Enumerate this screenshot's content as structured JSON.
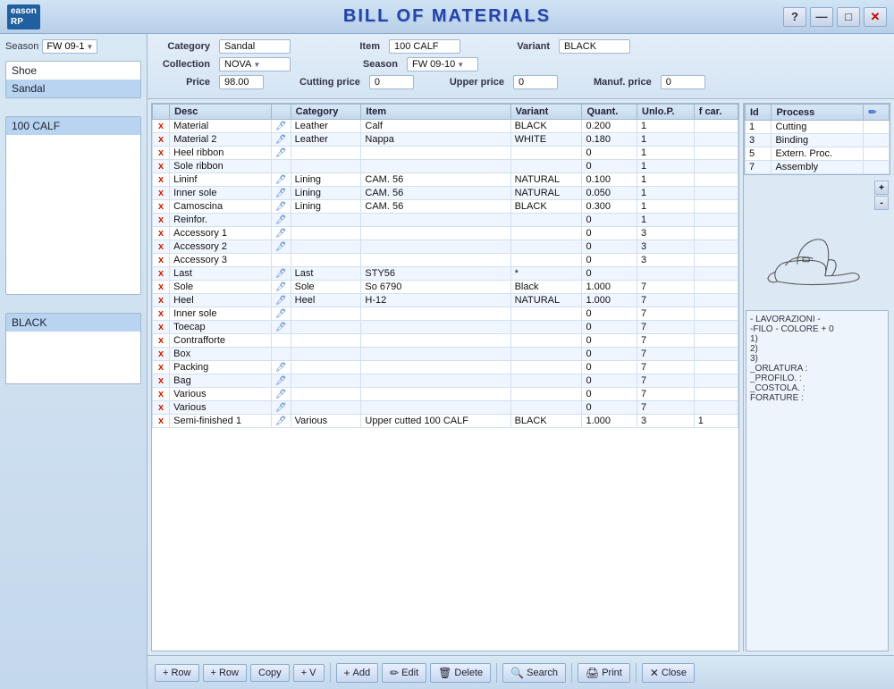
{
  "app": {
    "logo_line1": "eason",
    "logo_line2": "RP",
    "title": "BILL OF MATERIALS"
  },
  "window_controls": {
    "help": "?",
    "minimize": "—",
    "maximize": "□",
    "close": "✕"
  },
  "left_panel": {
    "season_label": "Season",
    "season_value": "FW 09-1",
    "lists": {
      "categories": [
        "Shoe",
        "Sandal"
      ],
      "items": [
        "100 CALF"
      ],
      "variants": [
        "BLACK"
      ]
    }
  },
  "form": {
    "category_label": "Category",
    "category_value": "Sandal",
    "item_label": "Item",
    "item_value": "100 CALF",
    "variant_label": "Variant",
    "variant_value": "BLACK",
    "collection_label": "Collection",
    "collection_value": "NOVA",
    "season_label": "Season",
    "season_value": "FW 09-10",
    "price_label": "Price",
    "price_value": "98.00",
    "cutting_price_label": "Cutting price",
    "cutting_price_value": "0",
    "upper_price_label": "Upper price",
    "upper_price_value": "0",
    "manuf_price_label": "Manuf. price",
    "manuf_price_value": "0"
  },
  "table": {
    "headers": [
      "",
      "Desc",
      "",
      "Category",
      "Item",
      "Variant",
      "Quant.",
      "Unlo.P.",
      "f car."
    ],
    "rows": [
      {
        "x": "x",
        "desc": "Material",
        "edit": true,
        "category": "Leather",
        "item": "Calf",
        "variant": "BLACK",
        "quant": "0.200",
        "unlo": "1",
        "fcar": ""
      },
      {
        "x": "x",
        "desc": "Material 2",
        "edit": true,
        "category": "Leather",
        "item": "Nappa",
        "variant": "WHITE",
        "quant": "0.180",
        "unlo": "1",
        "fcar": ""
      },
      {
        "x": "x",
        "desc": "Heel ribbon",
        "edit": true,
        "category": "",
        "item": "",
        "variant": "",
        "quant": "0",
        "unlo": "1",
        "fcar": ""
      },
      {
        "x": "x",
        "desc": "Sole ribbon",
        "edit": false,
        "category": "",
        "item": "",
        "variant": "",
        "quant": "0",
        "unlo": "1",
        "fcar": ""
      },
      {
        "x": "x",
        "desc": "Lininf",
        "edit": true,
        "category": "Lining",
        "item": "CAM. 56",
        "variant": "NATURAL",
        "quant": "0.100",
        "unlo": "1",
        "fcar": ""
      },
      {
        "x": "x",
        "desc": "Inner sole",
        "edit": true,
        "category": "Lining",
        "item": "CAM. 56",
        "variant": "NATURAL",
        "quant": "0.050",
        "unlo": "1",
        "fcar": ""
      },
      {
        "x": "x",
        "desc": "Camoscina",
        "edit": true,
        "category": "Lining",
        "item": "CAM. 56",
        "variant": "BLACK",
        "quant": "0.300",
        "unlo": "1",
        "fcar": ""
      },
      {
        "x": "x",
        "desc": "Reinfor.",
        "edit": true,
        "category": "",
        "item": "",
        "variant": "",
        "quant": "0",
        "unlo": "1",
        "fcar": ""
      },
      {
        "x": "x",
        "desc": "Accessory 1",
        "edit": true,
        "category": "",
        "item": "",
        "variant": "",
        "quant": "0",
        "unlo": "3",
        "fcar": ""
      },
      {
        "x": "x",
        "desc": "Accessory 2",
        "edit": true,
        "category": "",
        "item": "",
        "variant": "",
        "quant": "0",
        "unlo": "3",
        "fcar": ""
      },
      {
        "x": "x",
        "desc": "Accessory 3",
        "edit": false,
        "category": "",
        "item": "",
        "variant": "",
        "quant": "0",
        "unlo": "3",
        "fcar": ""
      },
      {
        "x": "x",
        "desc": "Last",
        "edit": true,
        "category": "Last",
        "item": "STY56",
        "variant": "*",
        "quant": "0",
        "unlo": "",
        "fcar": ""
      },
      {
        "x": "x",
        "desc": "Sole",
        "edit": true,
        "category": "Sole",
        "item": "So 6790",
        "variant": "Black",
        "quant": "1.000",
        "unlo": "7",
        "fcar": ""
      },
      {
        "x": "x",
        "desc": "Heel",
        "edit": true,
        "category": "Heel",
        "item": "H-12",
        "variant": "NATURAL",
        "quant": "1.000",
        "unlo": "7",
        "fcar": ""
      },
      {
        "x": "x",
        "desc": "Inner sole",
        "edit": true,
        "category": "",
        "item": "",
        "variant": "",
        "quant": "0",
        "unlo": "7",
        "fcar": ""
      },
      {
        "x": "x",
        "desc": "Toecap",
        "edit": true,
        "category": "",
        "item": "",
        "variant": "",
        "quant": "0",
        "unlo": "7",
        "fcar": ""
      },
      {
        "x": "x",
        "desc": "Contrafforte",
        "edit": false,
        "category": "",
        "item": "",
        "variant": "",
        "quant": "0",
        "unlo": "7",
        "fcar": ""
      },
      {
        "x": "x",
        "desc": "Box",
        "edit": false,
        "category": "",
        "item": "",
        "variant": "",
        "quant": "0",
        "unlo": "7",
        "fcar": ""
      },
      {
        "x": "x",
        "desc": "Packing",
        "edit": true,
        "category": "",
        "item": "",
        "variant": "",
        "quant": "0",
        "unlo": "7",
        "fcar": ""
      },
      {
        "x": "x",
        "desc": "Bag",
        "edit": true,
        "category": "",
        "item": "",
        "variant": "",
        "quant": "0",
        "unlo": "7",
        "fcar": ""
      },
      {
        "x": "x",
        "desc": "Various",
        "edit": true,
        "category": "",
        "item": "",
        "variant": "",
        "quant": "0",
        "unlo": "7",
        "fcar": ""
      },
      {
        "x": "x",
        "desc": "Various",
        "edit": true,
        "category": "",
        "item": "",
        "variant": "",
        "quant": "0",
        "unlo": "7",
        "fcar": ""
      },
      {
        "x": "x",
        "desc": "Semi-finished 1",
        "edit": true,
        "category": "Various",
        "item": "Upper cutted 100 CALF",
        "variant": "BLACK",
        "quant": "1.000",
        "unlo": "3",
        "fcar": "1"
      }
    ]
  },
  "process_panel": {
    "header": "Process",
    "edit_icon": "✏",
    "processes": [
      {
        "id": "1",
        "name": "Cutting"
      },
      {
        "id": "3",
        "name": "Binding"
      },
      {
        "id": "5",
        "name": "Extern. Proc."
      },
      {
        "id": "7",
        "name": "Assembly"
      }
    ]
  },
  "notes": {
    "line1": "- LAVORAZIONI -",
    "line2": "-FILO - COLORE + 0",
    "line3": "1)",
    "line4": "2)",
    "line5": "3)",
    "line6": "_ORLATURA :",
    "line7": "_PROFILO. :",
    "line8": "_COSTOLA. :",
    "line9": "FORATURE :"
  },
  "toolbar": {
    "add_row_label": "+ Row",
    "add_row2_label": "+ Row",
    "copy_label": "Copy",
    "plus_v_label": "+ V",
    "add_icon": "+",
    "add_label": "Add",
    "edit_icon": "✏",
    "edit_label": "Edit",
    "delete_icon": "🗑",
    "delete_label": "Delete",
    "search_icon": "🔍",
    "search_label": "Search",
    "print_icon": "🖨",
    "print_label": "Print",
    "close_icon": "✕",
    "close_label": "Close"
  }
}
